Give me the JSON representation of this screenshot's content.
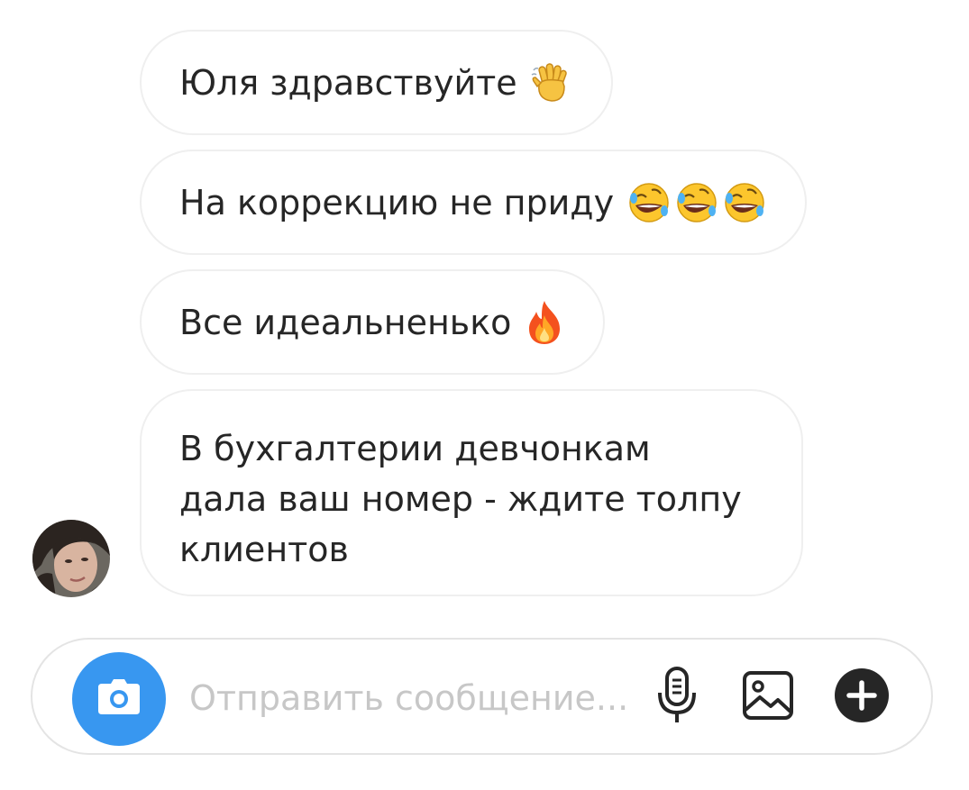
{
  "messages": [
    {
      "text": "Юля здравствуйте",
      "emoji": "👋"
    },
    {
      "text": "На коррекцию не приду",
      "emoji": "🤣🤣🤣"
    },
    {
      "text": "Все идеальненько",
      "emoji": "🔥"
    },
    {
      "lines": [
        "В бухгалтерии девчонкам",
        "дала ваш номер - ждите толпу",
        "клиентов"
      ]
    }
  ],
  "composer": {
    "placeholder": "Отправить сообщение..."
  },
  "icons": {
    "camera": "camera-icon",
    "microphone": "microphone-icon",
    "gallery": "image-icon",
    "add": "plus-icon"
  },
  "colors": {
    "accent": "#3897f0",
    "bubble_border": "#efefef",
    "text": "#262626",
    "placeholder": "#c7c7c7"
  }
}
